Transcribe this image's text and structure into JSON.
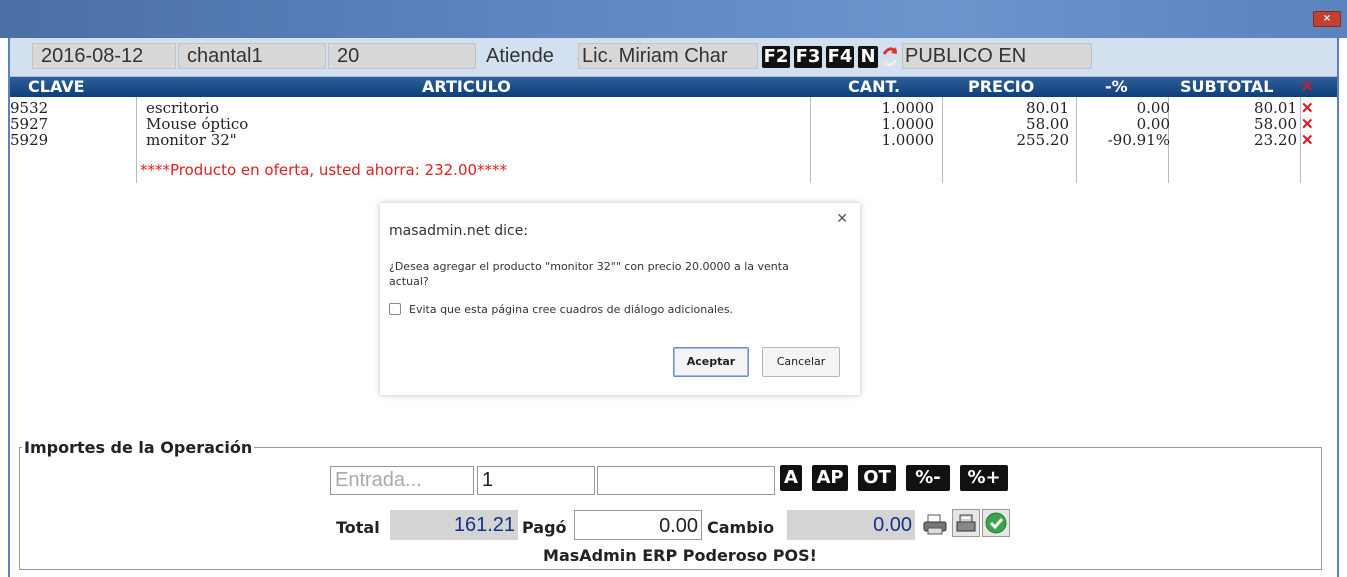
{
  "window": {
    "close_symbol": "×"
  },
  "header": {
    "date": "2016-08-12",
    "user": "chantal1",
    "number": "20",
    "attends_label": "Atiende",
    "attendant": "Lic. Miriam Char",
    "key_buttons": [
      "F2",
      "F3",
      "F4",
      "N"
    ],
    "client": "PUBLICO EN"
  },
  "columns": {
    "clave": "CLAVE",
    "articulo": "ARTICULO",
    "cant": "CANT.",
    "precio": "PRECIO",
    "desc": "-%",
    "subtotal": "SUBTOTAL"
  },
  "rows": [
    {
      "clave": "9532",
      "articulo": "escritorio",
      "cant": "1.0000",
      "precio": "80.01",
      "desc": "0.00",
      "subtotal": "80.01"
    },
    {
      "clave": "5927",
      "articulo": "Mouse óptico",
      "cant": "1.0000",
      "precio": "58.00",
      "desc": "0.00",
      "subtotal": "58.00"
    },
    {
      "clave": "5929",
      "articulo": "monitor 32\"",
      "cant": "1.0000",
      "precio": "255.20",
      "desc": "-90.91%",
      "subtotal": "23.20"
    }
  ],
  "offer_note": "****Producto en oferta, usted ahorra: 232.00****",
  "dialog": {
    "title": "masadmin.net dice:",
    "message": "¿Desea agregar el producto \"monitor 32\"\" con precio 20.0000 a la venta actual?",
    "checkbox_label": "Evita que esta página cree cuadros de diálogo adicionales.",
    "accept": "Aceptar",
    "cancel": "Cancelar"
  },
  "importes": {
    "legend": "Importes de la Operación",
    "entrada_placeholder": "Entrada...",
    "qty_value": "1",
    "third_value": "",
    "buttons": [
      "A",
      "AP",
      "OT",
      "%-",
      "%+"
    ],
    "total_label": "Total",
    "total_value": "161.21",
    "pago_label": "Pagó",
    "pago_value": "0.00",
    "cambio_label": "Cambio",
    "cambio_value": "0.00",
    "footer": "MasAdmin ERP Poderoso POS!"
  },
  "colors": {
    "header_blue": "#0f3f7a",
    "delete_red": "#e01b1b",
    "total_text": "#1a2f8a"
  }
}
